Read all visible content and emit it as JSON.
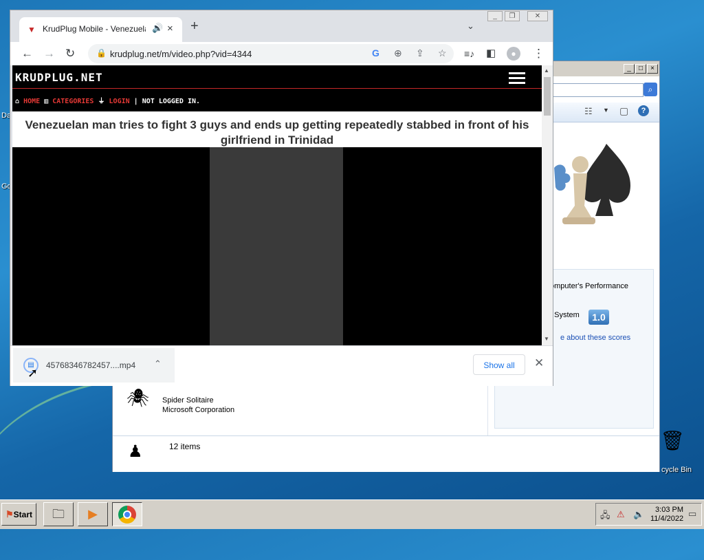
{
  "desktop": {
    "label_da": "Da",
    "label_go": "Go",
    "recycle_bin": "cycle Bin"
  },
  "explorer": {
    "rightpane": {
      "performance": "omputer's Performance",
      "system": "t System",
      "score": "1.0",
      "link": "e about these scores"
    },
    "game": {
      "name": "Spider Solitaire",
      "publisher": "Microsoft Corporation"
    },
    "status": "12 items"
  },
  "chrome": {
    "tab": {
      "title": "KrudPlug Mobile - Venezuela",
      "favicon": "krudplug-favicon"
    },
    "address": {
      "url": "krudplug.net/m/video.php?vid=4344"
    },
    "page": {
      "logo": "KRUDPLUG.NET",
      "nav": {
        "home": "HOME",
        "categories": "CATEGORIES",
        "login": "LOGIN",
        "separator": "|",
        "status": "NOT LOGGED IN."
      },
      "title": "Venezuelan man tries to fight 3 guys and ends up getting repeatedly stabbed in front of his girlfriend in Trinidad"
    },
    "downloads": {
      "filename": "45768346782457....mp4",
      "show_all": "Show all"
    }
  },
  "taskbar": {
    "start": "Start",
    "time": "3:03 PM",
    "date": "11/4/2022"
  }
}
